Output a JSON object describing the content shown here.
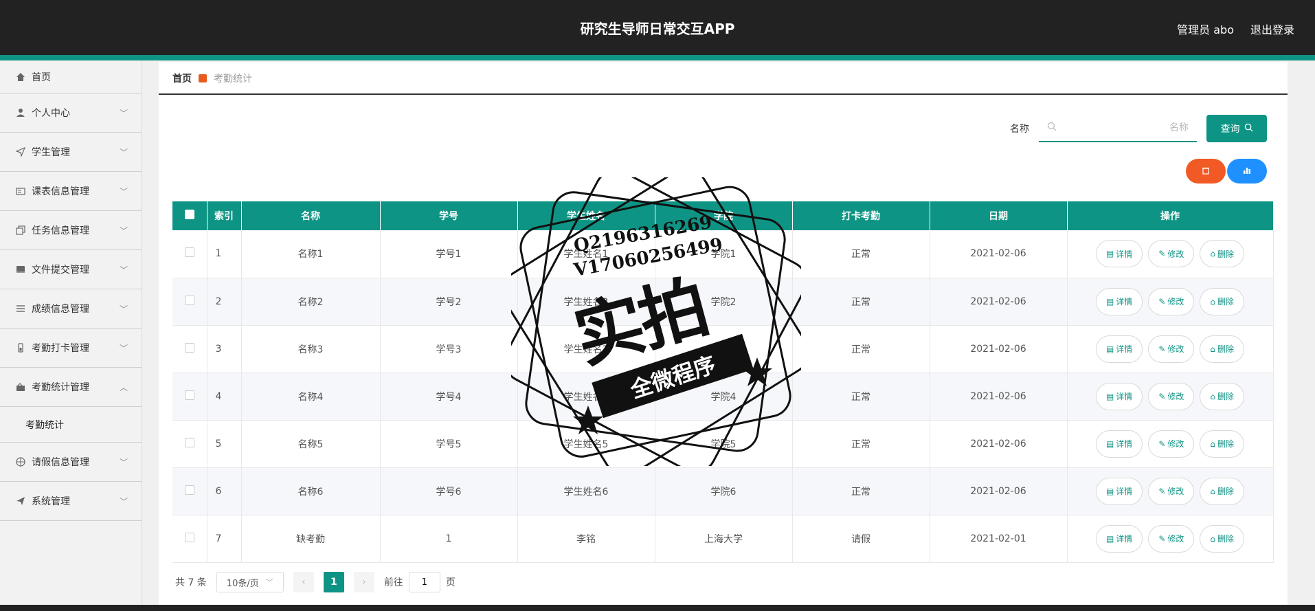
{
  "header": {
    "title": "研究生导师日常交互APP",
    "user": "管理员 abo",
    "logout": "退出登录"
  },
  "sidebar": {
    "items": [
      {
        "label": "首页",
        "icon": "home-icon"
      },
      {
        "label": "个人中心",
        "icon": "user-icon"
      },
      {
        "label": "学生管理",
        "icon": "send-icon"
      },
      {
        "label": "课表信息管理",
        "icon": "card-icon"
      },
      {
        "label": "任务信息管理",
        "icon": "copy-icon"
      },
      {
        "label": "文件提交管理",
        "icon": "box-icon"
      },
      {
        "label": "成绩信息管理",
        "icon": "list-icon"
      },
      {
        "label": "考勤打卡管理",
        "icon": "battery-icon"
      },
      {
        "label": "考勤统计管理",
        "icon": "brief-icon"
      },
      {
        "label": "请假信息管理",
        "icon": "target-icon"
      },
      {
        "label": "系统管理",
        "icon": "paper-plane-icon"
      }
    ],
    "sub_item": "考勤统计"
  },
  "breadcrumb": {
    "home": "首页",
    "current": "考勤统计"
  },
  "search": {
    "label": "名称",
    "placeholder": "名称",
    "button": "查询"
  },
  "table": {
    "headers": [
      "索引",
      "名称",
      "学号",
      "学生姓名",
      "学院",
      "打卡考勤",
      "日期",
      "操作"
    ],
    "rows": [
      {
        "idx": "1",
        "name": "名称1",
        "sid": "学号1",
        "student": "学生姓名1",
        "college": "学院1",
        "status": "正常",
        "date": "2021-02-06"
      },
      {
        "idx": "2",
        "name": "名称2",
        "sid": "学号2",
        "student": "学生姓名2",
        "college": "学院2",
        "status": "正常",
        "date": "2021-02-06"
      },
      {
        "idx": "3",
        "name": "名称3",
        "sid": "学号3",
        "student": "学生姓名3",
        "college": "学院3",
        "status": "正常",
        "date": "2021-02-06"
      },
      {
        "idx": "4",
        "name": "名称4",
        "sid": "学号4",
        "student": "学生姓名4",
        "college": "学院4",
        "status": "正常",
        "date": "2021-02-06"
      },
      {
        "idx": "5",
        "name": "名称5",
        "sid": "学号5",
        "student": "学生姓名5",
        "college": "学院5",
        "status": "正常",
        "date": "2021-02-06"
      },
      {
        "idx": "6",
        "name": "名称6",
        "sid": "学号6",
        "student": "学生姓名6",
        "college": "学院6",
        "status": "正常",
        "date": "2021-02-06"
      },
      {
        "idx": "7",
        "name": "缺考勤",
        "sid": "1",
        "student": "李铭",
        "college": "上海大学",
        "status": "请假",
        "date": "2021-02-01"
      }
    ],
    "ops": {
      "detail": "详情",
      "edit": "修改",
      "delete": "删除"
    }
  },
  "pager": {
    "total": "共 7 条",
    "page_size": "10条/页",
    "current": "1",
    "goto_label": "前往",
    "goto_value": "1",
    "page_suffix": "页"
  },
  "watermark": {
    "line1": "Q2196316269",
    "line2": "V17060256499",
    "big": "实拍",
    "banner": "全微程序"
  }
}
